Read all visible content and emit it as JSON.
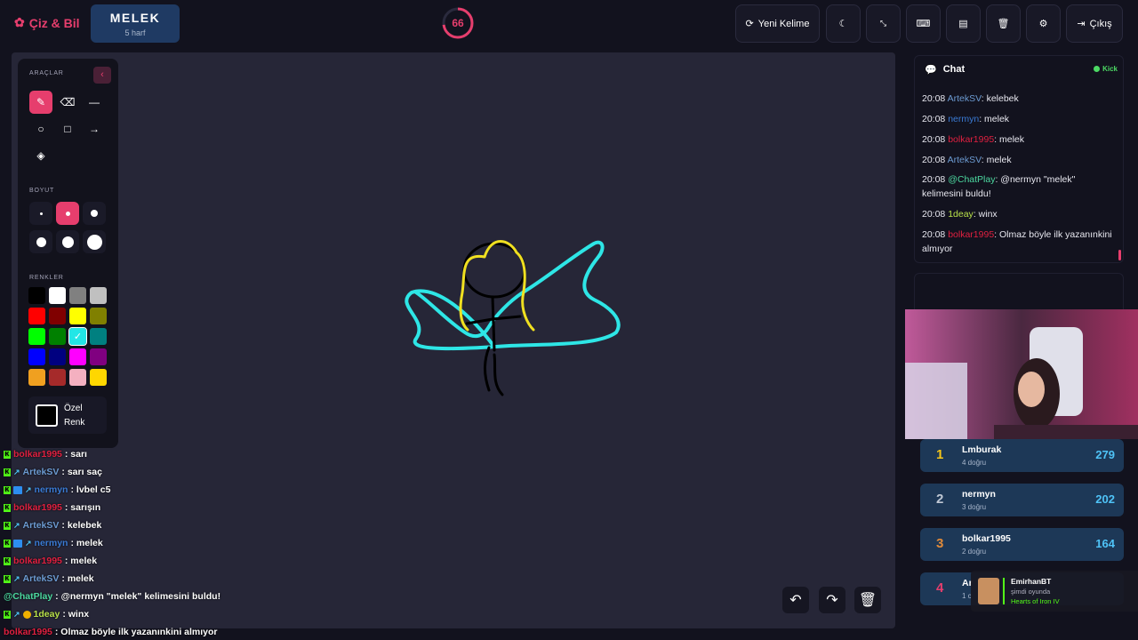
{
  "app": {
    "logo": "Çiz & Bil"
  },
  "word": {
    "text": "MELEK",
    "hint": "5 harf"
  },
  "timer": {
    "value": "66",
    "fraction": 0.73
  },
  "toolbar": {
    "new_word": "Yeni Kelime",
    "exit": "Çıkış"
  },
  "tools": {
    "section_tools": "ARAÇLAR",
    "section_size": "BOYUT",
    "section_colors": "RENKLER",
    "custom_color_line1": "Özel",
    "custom_color_line2": "Renk",
    "active_tool": "brush",
    "active_size": 2,
    "selected_color": "#22e6e6"
  },
  "colors": [
    "#000000",
    "#ffffff",
    "#808080",
    "#c0c0c0",
    "#ff0000",
    "#800000",
    "#ffff00",
    "#808000",
    "#00ff00",
    "#008000",
    "#22e6e6",
    "#008080",
    "#0000ff",
    "#000080",
    "#ff00ff",
    "#800080",
    "#f0a020",
    "#a52a2a",
    "#f4b0c0",
    "#ffd700"
  ],
  "overlay_chat": [
    {
      "user": "bolkar1995",
      "msg": ": sarı",
      "color": "#e02040",
      "badges": [
        "kick"
      ]
    },
    {
      "user": "ArtekSV",
      "msg": ": sarı saç",
      "color": "#6c9bd2",
      "badges": [
        "kick",
        "sub"
      ]
    },
    {
      "user": "nermyn",
      "msg": ": lvbel c5",
      "color": "#3a7bd5",
      "badges": [
        "kick",
        "boost",
        "sub"
      ]
    },
    {
      "user": "bolkar1995",
      "msg": ": sarışın",
      "color": "#e02040",
      "badges": [
        "kick"
      ]
    },
    {
      "user": "ArtekSV",
      "msg": ": kelebek",
      "color": "#6c9bd2",
      "badges": [
        "kick",
        "sub"
      ]
    },
    {
      "user": "nermyn",
      "msg": ": melek",
      "color": "#3a7bd5",
      "badges": [
        "kick",
        "boost",
        "sub"
      ]
    },
    {
      "user": "bolkar1995",
      "msg": ": melek",
      "color": "#e02040",
      "badges": [
        "kick"
      ]
    },
    {
      "user": "ArtekSV",
      "msg": ": melek",
      "color": "#6c9bd2",
      "badges": [
        "kick",
        "sub"
      ]
    },
    {
      "user": "@ChatPlay",
      "msg": ": @nermyn \"melek\" kelimesini buldu!",
      "color": "#4cd9a0",
      "badges": []
    },
    {
      "user": "1deay",
      "msg": ": winx",
      "color": "#b8e04a",
      "badges": [
        "kick",
        "sub",
        "gift"
      ]
    },
    {
      "user": "bolkar1995",
      "msg": ": Olmaz böyle ilk yazanınkini almıyor",
      "color": "#e02040",
      "badges": []
    }
  ],
  "chat": {
    "title": "Chat",
    "status": "Kick",
    "messages": [
      {
        "time": "20:08",
        "user": "ArtekSV",
        "text": ": kelebek",
        "color": "#6c9bd2"
      },
      {
        "time": "20:08",
        "user": "nermyn",
        "text": ": melek",
        "color": "#3a7bd5"
      },
      {
        "time": "20:08",
        "user": "bolkar1995",
        "text": ": melek",
        "color": "#e02040"
      },
      {
        "time": "20:08",
        "user": "ArtekSV",
        "text": ": melek",
        "color": "#6c9bd2"
      },
      {
        "time": "20:08",
        "user": "@ChatPlay",
        "text": ": @nermyn \"melek\" kelimesini buldu!",
        "color": "#4cd9a0"
      },
      {
        "time": "20:08",
        "user": "1deay",
        "text": ": winx",
        "color": "#b8e04a"
      },
      {
        "time": "20:08",
        "user": "bolkar1995",
        "text": ": Olmaz böyle ilk yazanınkini almıyor",
        "color": "#e02040"
      }
    ]
  },
  "leaderboard": [
    {
      "rank": "1",
      "name": "Lmburak",
      "sub": "4 doğru",
      "score": "279",
      "color": "#f5c518"
    },
    {
      "rank": "2",
      "name": "nermyn",
      "sub": "3 doğru",
      "score": "202",
      "color": "#c0c8d4"
    },
    {
      "rank": "3",
      "name": "bolkar1995",
      "sub": "2 doğru",
      "score": "164",
      "color": "#e08a3a"
    },
    {
      "rank": "4",
      "name": "Ar",
      "sub": "1 c",
      "score": "",
      "color": "#e63e6d"
    }
  ],
  "notification": {
    "user": "EmirhanBT",
    "line": "şimdi oyunda",
    "game": "Hearts of Iron IV"
  }
}
